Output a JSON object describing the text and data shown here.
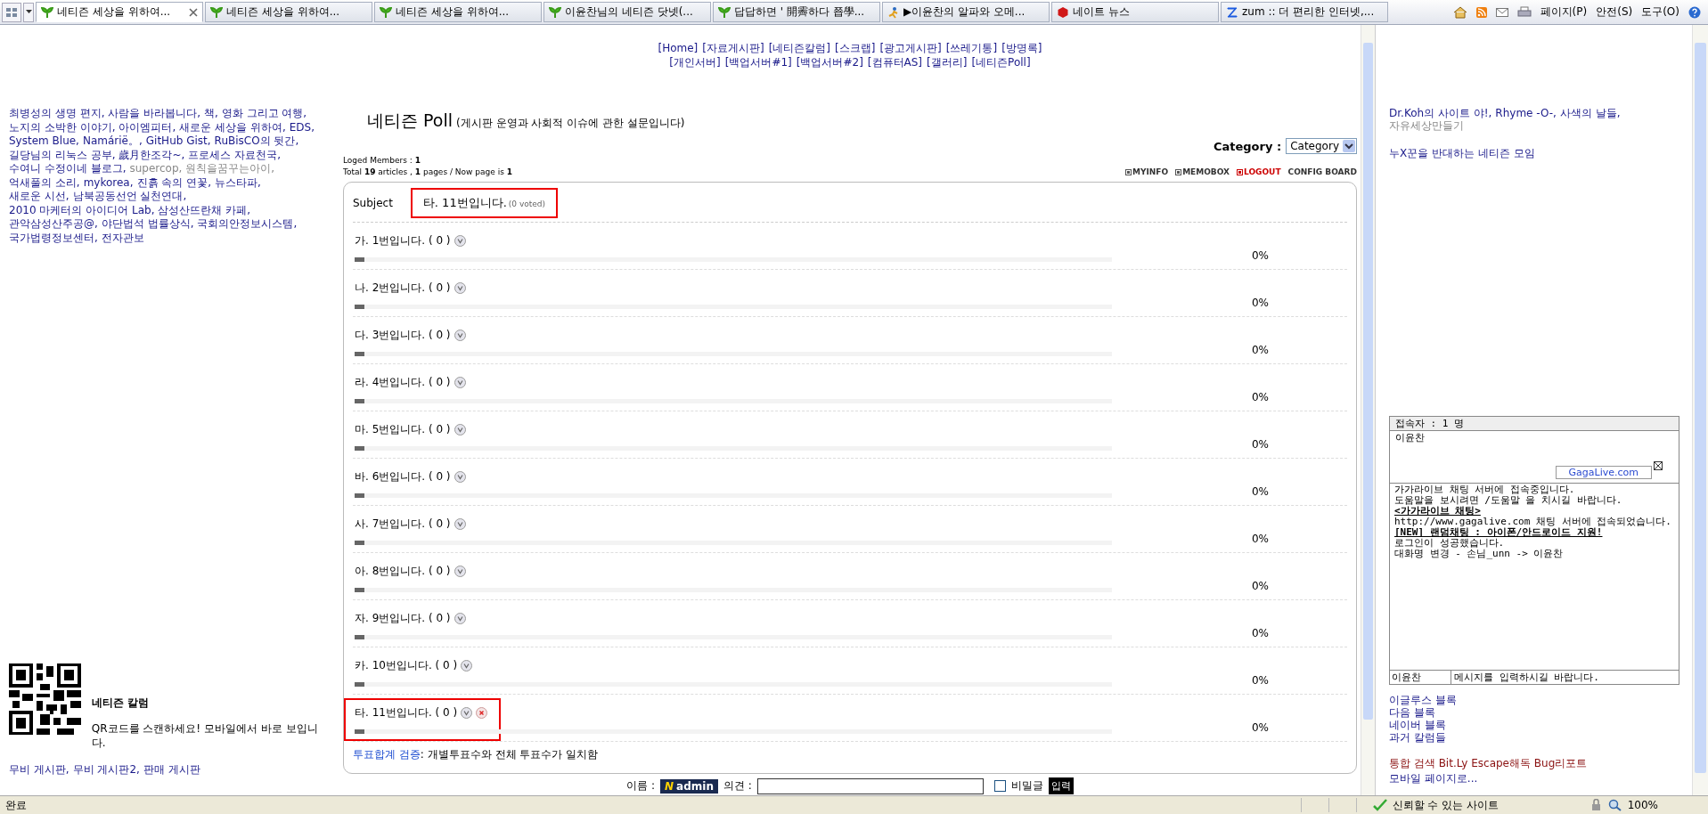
{
  "browser": {
    "tabs": [
      {
        "label": "네티즌 세상을 위하여...",
        "selected": true
      },
      {
        "label": "네티즌 세상을 위하여...",
        "selected": false
      },
      {
        "label": "네티즌 세상을 위하여...",
        "selected": false
      },
      {
        "label": "이윤찬님의 네티즌 닷넷(...",
        "selected": false
      },
      {
        "label": "답답하면 ' 開霽하다 쬽學...",
        "selected": false
      },
      {
        "label": "▶이윤찬의 알파와 오메...",
        "selected": false
      },
      {
        "label": "네이트 뉴스",
        "selected": false
      },
      {
        "label": "zum :: 더 편리한 인터넷,...",
        "selected": false
      }
    ],
    "menus": [
      "페이지(P)",
      "안전(S)",
      "도구(O)"
    ]
  },
  "nav": [
    [
      "[Home]",
      "[자료게시판]",
      "[네티즌칼럼]",
      "[스크랩]",
      "[광고게시판]",
      "[쓰레기통]",
      "[방명록]"
    ],
    [
      "[개인서버]",
      "[백업서버#1]",
      "[백업서버#2]",
      "[컴퓨터AS]",
      "[갤러리]",
      "[네티즌Poll]"
    ]
  ],
  "left": {
    "links": [
      {
        "text": "최병성의 생명 편지,",
        "muted": false
      },
      {
        "text": "사람을 바라봅니다,",
        "muted": false
      },
      {
        "text": "책, 영화 그리고 여행,",
        "muted": false
      },
      {
        "text": "노지의 소박한 이야기,",
        "muted": false
      },
      {
        "text": "아이엠피터,",
        "muted": false
      },
      {
        "text": "새로운 세상을 위하여,",
        "muted": false
      },
      {
        "text": "EDS,",
        "muted": false
      },
      {
        "text": "System Blue,",
        "muted": false
      },
      {
        "text": "Namárië。,",
        "muted": false
      },
      {
        "text": "GitHub Gist,",
        "muted": false
      },
      {
        "text": "RuBisCO의 뒷간,",
        "muted": false
      },
      {
        "text": "길당님의 리눅스 공부,",
        "muted": false
      },
      {
        "text": "歲月한조각~,",
        "muted": false
      },
      {
        "text": "프로세스 자료천국,",
        "muted": false
      },
      {
        "text": "수여니 수정이네 블로그,",
        "muted": false
      },
      {
        "text": "supercop,",
        "muted": true
      },
      {
        "text": "원칙을꿈꾸는아이,",
        "muted": true
      },
      {
        "text": "억새풀의 소리,",
        "muted": false
      },
      {
        "text": "mykorea,",
        "muted": false
      },
      {
        "text": "진흙 속의 연꽃,",
        "muted": false
      },
      {
        "text": "뉴스타파,",
        "muted": false
      },
      {
        "text": "새로운 시선,",
        "muted": false
      },
      {
        "text": "남북공동선언 실천연대,",
        "muted": false
      },
      {
        "text": "2010 마케터의 아이디어 Lab,",
        "muted": false
      },
      {
        "text": "삼성산뜨란채 카페,",
        "muted": false
      },
      {
        "text": "관악삼성산주공@,",
        "muted": false
      },
      {
        "text": "야단법석 법률상식,",
        "muted": false
      },
      {
        "text": "국회의안정보시스템,",
        "muted": false
      },
      {
        "text": "국가법령정보센터,",
        "muted": false
      },
      {
        "text": "전자관보",
        "muted": false
      }
    ],
    "qr": {
      "title": "네티즌 칼럼",
      "text": "QR코드를 스캔하세요! 모바일에서 바로 보입니다."
    },
    "bottom_links": [
      "무비 게시판,",
      "무비 게시판2,",
      "판매 게시판"
    ]
  },
  "poll": {
    "title": "네티즌 Poll",
    "subtitle": "(게시판 운영과 사회적 이슈에 관한 설문입니다)",
    "category_label": "Category :",
    "category_select": "Category",
    "members": "Loged Members : **1**",
    "totals": "Total **19** articles , **1** pages / Now page is **1**",
    "board_links": [
      {
        "label": "MYINFO",
        "kind": "info"
      },
      {
        "label": "MEMOBOX",
        "kind": "memo"
      },
      {
        "label": "LOGOUT",
        "kind": "logout"
      },
      {
        "label": "CONFIG BOARD",
        "kind": "config"
      }
    ],
    "subject": {
      "label": "Subject",
      "value": "타. 11번입니다.",
      "votes": "(0 voted)",
      "highlighted": true
    },
    "options": [
      {
        "label": "가. 1번입니다. ( 0 )",
        "level": 0,
        "percent": "0%",
        "highlighted": false,
        "deletable": false
      },
      {
        "label": "나. 2번입니다. ( 0 )",
        "level": 0,
        "percent": "0%",
        "highlighted": false,
        "deletable": false
      },
      {
        "label": "다. 3번입니다. ( 0 )",
        "level": 0,
        "percent": "0%",
        "highlighted": false,
        "deletable": false
      },
      {
        "label": "라. 4번입니다. ( 0 )",
        "level": 0,
        "percent": "0%",
        "highlighted": false,
        "deletable": false
      },
      {
        "label": "마. 5번입니다. ( 0 )",
        "level": 0,
        "percent": "0%",
        "highlighted": false,
        "deletable": false
      },
      {
        "label": "바. 6번입니다. ( 0 )",
        "level": 0,
        "percent": "0%",
        "highlighted": false,
        "deletable": false
      },
      {
        "label": "사. 7번입니다. ( 0 )",
        "level": 0,
        "percent": "0%",
        "highlighted": false,
        "deletable": false
      },
      {
        "label": "아. 8번입니다. ( 0 )",
        "level": 0,
        "percent": "0%",
        "highlighted": false,
        "deletable": false
      },
      {
        "label": "자. 9번입니다. ( 0 )",
        "level": 0,
        "percent": "0%",
        "highlighted": false,
        "deletable": false
      },
      {
        "label": "카. 10번입니다. ( 0 )",
        "level": 0,
        "percent": "0%",
        "highlighted": false,
        "deletable": false
      },
      {
        "label": "타. 11번입니다. ( 0 )",
        "level": 0,
        "percent": "0%",
        "highlighted": true,
        "deletable": true
      }
    ],
    "verify_link": "투표합계 검증",
    "verify_text": ": 개별투표수와 전체 투표수가 일치함",
    "comment": {
      "name_label": "이름 :",
      "name_logo": "N",
      "name": "admin",
      "opinion_label": "의견 :",
      "secret_label": "비밀글",
      "secret_checked": false,
      "submit": "입력"
    }
  },
  "right": {
    "links": [
      {
        "text": "Dr.Koh의 사이트 야!,",
        "muted": false
      },
      {
        "text": "Rhyme -O-,",
        "muted": false
      },
      {
        "text": "사색의 날들,",
        "muted": false
      },
      {
        "text": "자유세상만들기",
        "muted": true
      }
    ],
    "group_link": "누X꾼을 반대하는 네티즌 모임",
    "chat": {
      "header": "접속자 : 1 명",
      "users": [
        "이윤찬"
      ],
      "brand": "GagaLive.com",
      "messages": [
        {
          "text": "가가라이브 채팅 서버에 접속중입니다.",
          "kind": "plain"
        },
        {
          "text": "도움말을 보시려면 /도움말 을 치시길 바랍니다.",
          "kind": "plain"
        },
        {
          "text": "<가가라이브 채팅>",
          "kind": "notice"
        },
        {
          "text": "http://www.gagalive.com 채팅 서버에 접속되었습니다.",
          "kind": "plain"
        },
        {
          "text": "[NEW] 랜덤채팅 : 아이폰/안드로이드 지원!",
          "kind": "notice"
        },
        {
          "text": "로그인이 성공했습니다.",
          "kind": "plain"
        },
        {
          "text": "대화명 변경 - 손님_unn -> 이윤찬",
          "kind": "plain"
        }
      ],
      "nick": "이윤찬",
      "placeholder": "메시지를 입력하시길 바랍니다."
    },
    "blogs": [
      "이글루스 블록",
      "다음 블록",
      "네이버 블록",
      "과거 칼럼들"
    ],
    "tools": "통합 검색 Bit.Ly Escape해독 Bug리포트",
    "mobile": "모바일 페이지로..."
  },
  "status_bar": {
    "text": "완료",
    "zone": "신뢰할 수 있는 사이트",
    "zoom": "100%"
  }
}
